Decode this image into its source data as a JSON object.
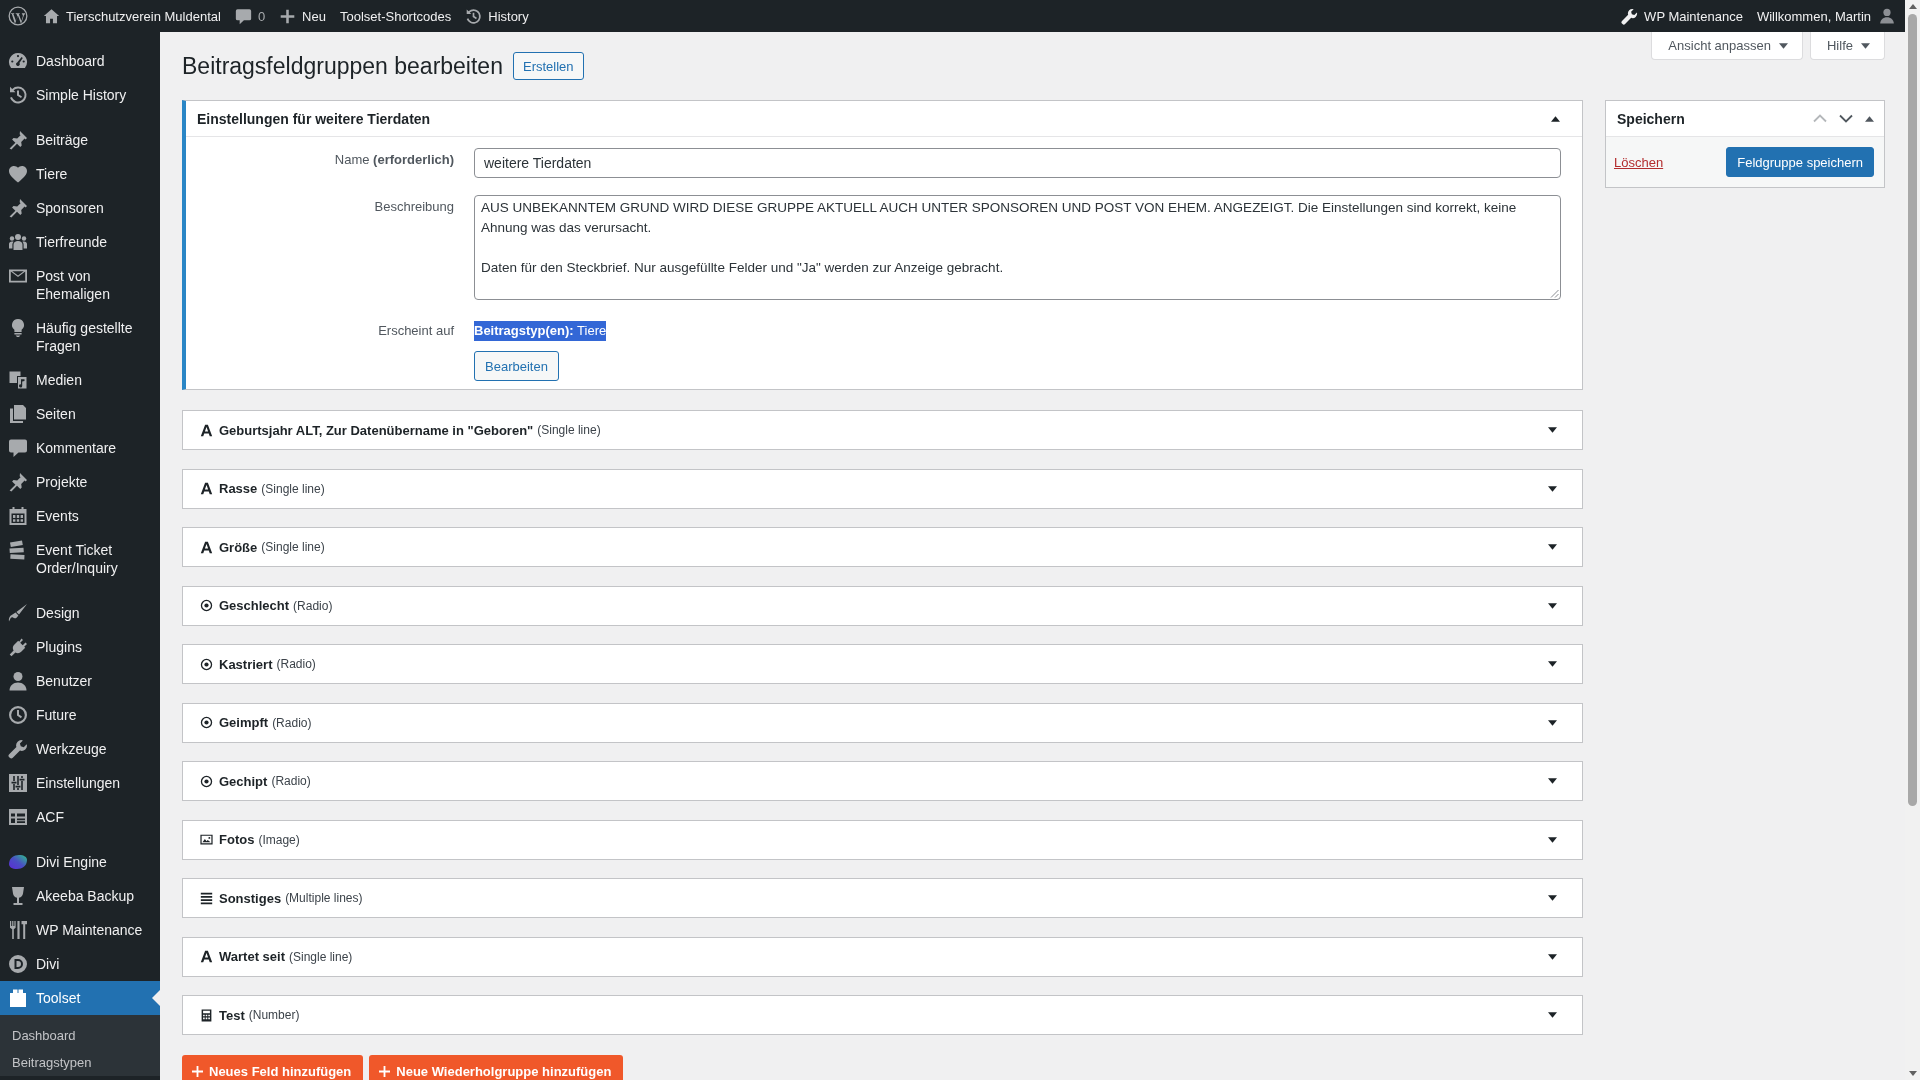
{
  "admin_bar": {
    "left": [
      {
        "kind": "logo"
      },
      {
        "kind": "home",
        "label": "Tierschutzverein Muldental"
      },
      {
        "kind": "comments",
        "label": "0"
      },
      {
        "kind": "new",
        "label": "Neu"
      },
      {
        "kind": "plain",
        "label": "Toolset-Shortcodes"
      },
      {
        "kind": "history",
        "label": "History"
      }
    ],
    "right": [
      {
        "kind": "wrench",
        "label": "WP Maintenance"
      },
      {
        "kind": "account",
        "label": "Willkommen, Martin"
      }
    ]
  },
  "sidebar": {
    "groups": [
      {
        "items": [
          {
            "kind": "dashboard",
            "label": "Dashboard",
            "selected": false
          },
          {
            "kind": "history",
            "label": "Simple History",
            "selected": false
          }
        ]
      },
      {
        "items": [
          {
            "kind": "pin",
            "label": "Beiträge",
            "selected": false
          },
          {
            "kind": "heart",
            "label": "Tiere",
            "selected": false
          },
          {
            "kind": "pin",
            "label": "Sponsoren",
            "selected": false
          },
          {
            "kind": "group",
            "label": "Tierfreunde",
            "selected": false
          },
          {
            "kind": "envelope",
            "label": "Post von Ehemaligen",
            "selected": false
          },
          {
            "kind": "bulb",
            "label": "Häufig gestellte Fragen",
            "selected": false
          },
          {
            "kind": "media",
            "label": "Medien",
            "selected": false
          },
          {
            "kind": "pages",
            "label": "Seiten",
            "selected": false
          },
          {
            "kind": "comment",
            "label": "Kommentare",
            "selected": false
          },
          {
            "kind": "pin",
            "label": "Projekte",
            "selected": false
          },
          {
            "kind": "calendar",
            "label": "Events",
            "selected": false
          },
          {
            "kind": "tickets",
            "label": "Event Ticket Order/Inquiry",
            "selected": false
          }
        ]
      },
      {
        "items": [
          {
            "kind": "brush",
            "label": "Design",
            "selected": false
          },
          {
            "kind": "plug",
            "label": "Plugins",
            "selected": false
          },
          {
            "kind": "user",
            "label": "Benutzer",
            "selected": false
          },
          {
            "kind": "clock",
            "label": "Future",
            "selected": false
          },
          {
            "kind": "wrench",
            "label": "Werkzeuge",
            "selected": false
          },
          {
            "kind": "sliders",
            "label": "Einstellungen",
            "selected": false
          },
          {
            "kind": "table",
            "label": "ACF",
            "selected": false
          }
        ]
      },
      {
        "items": [
          {
            "kind": "blob",
            "label": "Divi Engine",
            "selected": false
          },
          {
            "kind": "glass",
            "label": "Akeeba Backup",
            "selected": false
          },
          {
            "kind": "tools",
            "label": "WP Maintenance",
            "selected": false
          },
          {
            "kind": "circle_d",
            "label": "Divi",
            "selected": false
          },
          {
            "kind": "blocks",
            "label": "Toolset",
            "selected": true,
            "children": [
              {
                "label": "Dashboard",
                "selected": false
              },
              {
                "label": "Beitragstypen",
                "selected": false
              }
            ]
          }
        ]
      }
    ]
  },
  "screen_tabs": [
    {
      "label": "Ansicht anpassen",
      "expanded": false
    },
    {
      "label": "Hilfe",
      "expanded": false
    }
  ],
  "page": {
    "title": "Beitragsfeldgruppen bearbeiten",
    "action_button": "Erstellen"
  },
  "settings_panel": {
    "title": "Einstellungen für weitere Tierdaten",
    "expanded": true,
    "name": {
      "label": "Name **(erforderlich)**",
      "value": "weitere Tierdaten"
    },
    "description": {
      "label": "Beschreibung",
      "value": "AUS UNBEKANNTEM GRUND WIRD DIESE GRUPPE AKTUELL AUCH UNTER SPONSOREN UND POST VON EHEM. ANGEZEIGT. Die Einstellungen sind korrekt, keine Ahnung was das verursacht.\n\nDaten für den Steckbrief. Nur ausgefüllte Felder und \"Ja\" werden zur Anzeige gebracht."
    },
    "appears_on": {
      "label": "Erscheint auf",
      "value": "**Beitragstyp(en):** Tiere",
      "highlighted": true,
      "edit_button": "Bearbeiten"
    }
  },
  "fields": [
    {
      "kind": "single_line",
      "name": "Geburtsjahr ALT, Zur Datenübername in \"Geboren\"",
      "type_label": "(Single line)",
      "expanded": false
    },
    {
      "kind": "single_line",
      "name": "Rasse",
      "type_label": "(Single line)",
      "expanded": false
    },
    {
      "kind": "single_line",
      "name": "Größe",
      "type_label": "(Single line)",
      "expanded": false
    },
    {
      "kind": "radio",
      "name": "Geschlecht",
      "type_label": "(Radio)",
      "expanded": false
    },
    {
      "kind": "radio",
      "name": "Kastriert",
      "type_label": "(Radio)",
      "expanded": false
    },
    {
      "kind": "radio",
      "name": "Geimpft",
      "type_label": "(Radio)",
      "expanded": false
    },
    {
      "kind": "radio",
      "name": "Gechipt",
      "type_label": "(Radio)",
      "expanded": false
    },
    {
      "kind": "image",
      "name": "Fotos",
      "type_label": "(Image)",
      "expanded": false
    },
    {
      "kind": "multiple_lines",
      "name": "Sonstiges",
      "type_label": "(Multiple lines)",
      "expanded": false
    },
    {
      "kind": "single_line",
      "name": "Wartet seit",
      "type_label": "(Single line)",
      "expanded": false
    },
    {
      "kind": "number",
      "name": "Test",
      "type_label": "(Number)",
      "expanded": false
    }
  ],
  "add_buttons": [
    "Neues Feld hinzufügen",
    "Neue Wiederholgruppe hinzufügen"
  ],
  "save_box": {
    "title": "Speichern",
    "expanded": true,
    "order_buttons": [
      {
        "kind": "up",
        "disabled": true
      },
      {
        "kind": "down",
        "disabled": false
      }
    ],
    "delete_link": "Löschen",
    "save_button": "Feldgruppe speichern"
  }
}
